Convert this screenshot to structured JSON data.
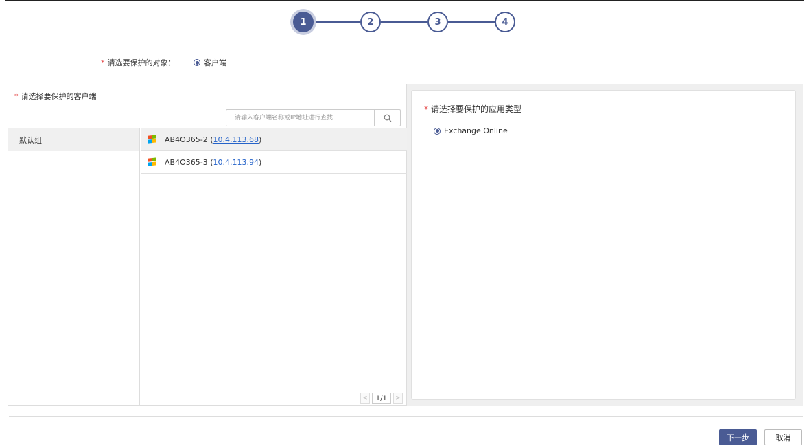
{
  "stepper": {
    "steps": [
      {
        "label": "1",
        "active": true
      },
      {
        "label": "2",
        "active": false
      },
      {
        "label": "3",
        "active": false
      },
      {
        "label": "4",
        "active": false
      }
    ]
  },
  "object_row": {
    "required_mark": "*",
    "label": "请选要保护的对象：",
    "option": "客户端"
  },
  "client_panel": {
    "required_mark": "*",
    "title": "请选择要保护的客户端",
    "search_placeholder": "请输入客户端名称或IP地址进行查找",
    "search_icon": "search-icon",
    "groups": [
      {
        "label": "默认组",
        "selected": true
      }
    ],
    "clients": [
      {
        "name": "AB4O365-2",
        "ip": "10.4.113.68",
        "open": "(",
        "close": ")",
        "icon": "windows-icon",
        "selected": true
      },
      {
        "name": "AB4O365-3",
        "ip": "10.4.113.94",
        "open": "(",
        "close": ")",
        "icon": "windows-icon",
        "selected": false
      }
    ],
    "pagination": {
      "prev": "<",
      "page": "1/1",
      "next": ">"
    }
  },
  "app_panel": {
    "required_mark": "*",
    "title": "请选择要保护的应用类型",
    "option": "Exchange Online"
  },
  "footer": {
    "next_label": "下一步",
    "cancel_label": "取消"
  },
  "colors": {
    "primary": "#4a5b94",
    "required": "#e54848",
    "link": "#2563c9"
  }
}
